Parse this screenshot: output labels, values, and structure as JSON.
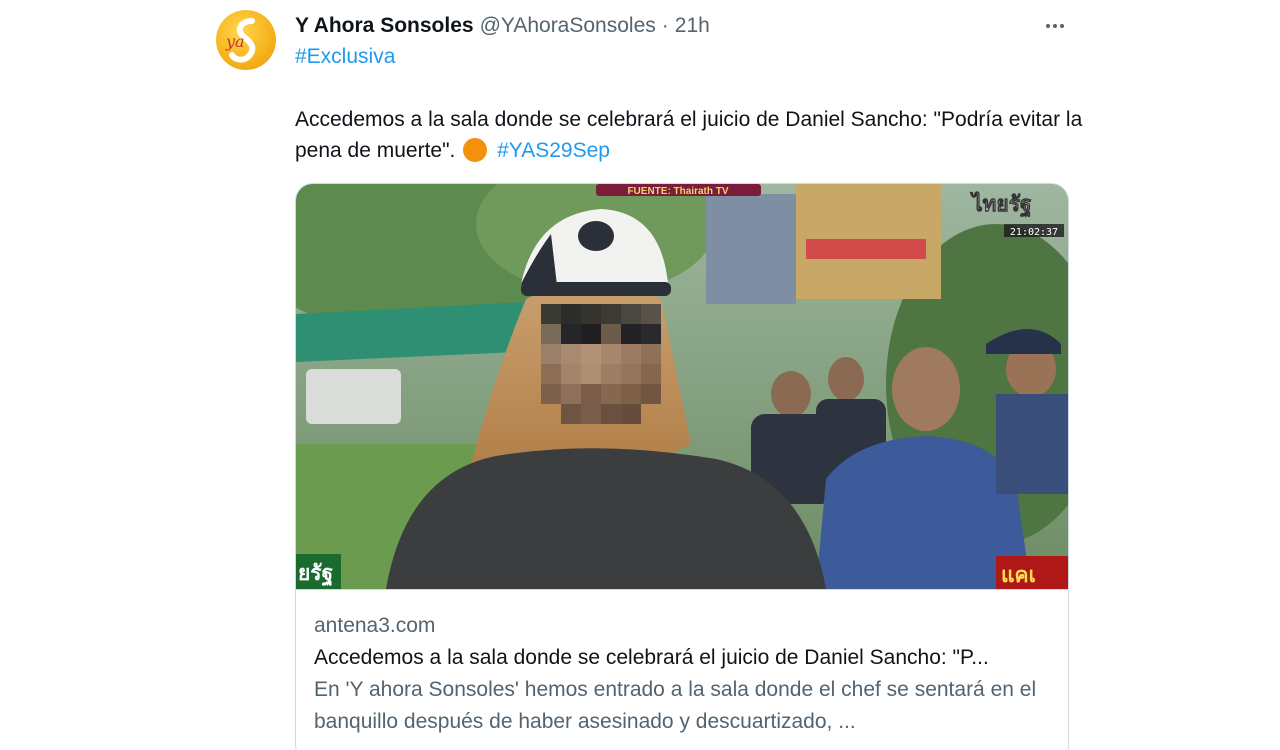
{
  "author": {
    "display_name": "Y Ahora Sonsoles",
    "handle": "@YAhoraSonsoles",
    "separator": "·",
    "timestamp": "21h",
    "avatar_icon": "ya-sonsoles-logo"
  },
  "more_icon": "more-horizontal-icon",
  "tweet": {
    "hashtag_top": "#Exclusiva",
    "text": "Accedemos a la sala donde se celebrará el juicio de Daniel Sancho: \"Podría evitar la pena de muerte\".",
    "hashtag_bottom": "#YAS29Sep"
  },
  "card": {
    "overlay_source": "FUENTE: Thairath TV",
    "overlay_channel": "ไทยรัฐ",
    "overlay_clock": "21:02:37",
    "overlay_bottom_left": "ยรัฐ",
    "overlay_bottom_right": "แคเ",
    "domain": "antena3.com",
    "title": "Accedemos a la sala donde se celebrará el juicio de Daniel Sancho: \"P...",
    "description": "En 'Y ahora Sonsoles' hemos entrado a la sala donde el chef se sentará en el banquillo después de haber asesinado y descuartizado, ..."
  },
  "colors": {
    "link_blue": "#1d9bf0",
    "secondary_text": "#536471",
    "primary_text": "#0f1419",
    "border": "#cfd9de",
    "emoji_orange": "#f4900c"
  }
}
